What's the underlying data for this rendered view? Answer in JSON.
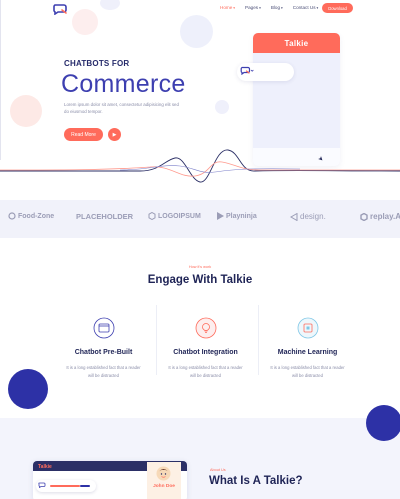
{
  "header": {
    "nav": [
      {
        "label": "Home",
        "active": true
      },
      {
        "label": "Pages",
        "active": false
      },
      {
        "label": "Blog",
        "active": false
      },
      {
        "label": "Contact Us",
        "active": false
      }
    ],
    "download_label": "Download"
  },
  "hero": {
    "subtitle": "CHATBOTS FOR",
    "title": "Commerce",
    "text": "Lorem ipsum dolor sit amet, consectetur adipisicing elit sed do eiusmod tempor.",
    "read_more_label": "Read More",
    "phone_title": "Talkie"
  },
  "brands": [
    "Food-Zone",
    "PLACEHOLDER",
    "LOGOIPSUM",
    "Playninja",
    "design.",
    "replay.A"
  ],
  "engage": {
    "eyebrow": "How it's work",
    "title": "Engage With Talkie",
    "cards": [
      {
        "title": "Chatbot Pre-Built",
        "text": "It is a long established fact that a reader will be distracted"
      },
      {
        "title": "Chatbot Integration",
        "text": "It is a long established fact that a reader will be distracted"
      },
      {
        "title": "Machine Learning",
        "text": "It is a long established fact that a reader will be distracted"
      }
    ]
  },
  "about": {
    "mock_title": "Talkie",
    "profile_name": "John Doe",
    "eyebrow": "About Us",
    "title": "What Is A Talkie?"
  },
  "colors": {
    "accent": "#ff6b5b",
    "primary": "#3d3fb0",
    "dark": "#1f2456",
    "navy_circle": "#2d31a6"
  },
  "icons": {
    "logo": "chat-logo-icon",
    "play": "play-icon",
    "send": "send-arrow-icon",
    "card_icons": [
      "chat-window-icon",
      "bulb-icon",
      "chip-icon"
    ]
  }
}
